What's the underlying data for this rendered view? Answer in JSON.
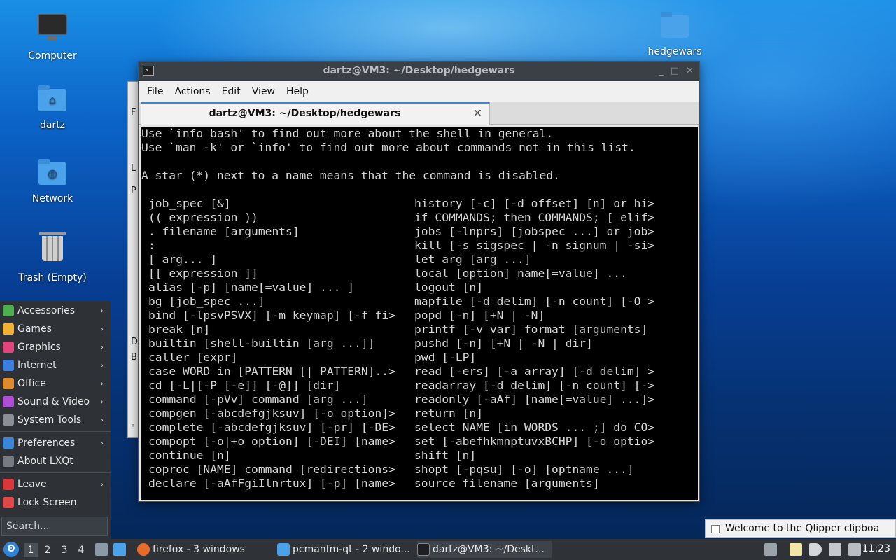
{
  "desktop": {
    "icons": [
      {
        "label": "Computer"
      },
      {
        "label": "dartz"
      },
      {
        "label": "Network"
      },
      {
        "label": "Trash (Empty)"
      },
      {
        "label": "hedgewars"
      }
    ]
  },
  "terminal": {
    "title": "dartz@VM3: ~/Desktop/hedgewars",
    "menu": [
      "File",
      "Actions",
      "Edit",
      "View",
      "Help"
    ],
    "tab_label": "dartz@VM3: ~/Desktop/hedgewars",
    "header_lines": [
      "Use `info bash' to find out more about the shell in general.",
      "Use `man -k' or `info' to find out more about commands not in this list.",
      "",
      "A star (*) next to a name means that the command is disabled."
    ],
    "left_column": [
      "job_spec [&]",
      "(( expression ))",
      ". filename [arguments]",
      ":",
      "[ arg... ]",
      "[[ expression ]]",
      "alias [-p] [name[=value] ... ]",
      "bg [job_spec ...]",
      "bind [-lpsvPSVX] [-m keymap] [-f fi>",
      "break [n]",
      "builtin [shell-builtin [arg ...]]",
      "caller [expr]",
      "case WORD in [PATTERN [| PATTERN]..>",
      "cd [-L|[-P [-e]] [-@]] [dir]",
      "command [-pVv] command [arg ...]",
      "compgen [-abcdefgjksuv] [-o option]>",
      "complete [-abcdefgjksuv] [-pr] [-DE>",
      "compopt [-o|+o option] [-DEI] [name>",
      "continue [n]",
      "coproc [NAME] command [redirections>",
      "declare [-aAfFgiIlnrtux] [-p] [name>"
    ],
    "right_column": [
      "history [-c] [-d offset] [n] or hi>",
      "if COMMANDS; then COMMANDS; [ elif>",
      "jobs [-lnprs] [jobspec ...] or job>",
      "kill [-s sigspec | -n signum | -si>",
      "let arg [arg ...]",
      "local [option] name[=value] ...",
      "logout [n]",
      "mapfile [-d delim] [-n count] [-O >",
      "popd [-n] [+N | -N]",
      "printf [-v var] format [arguments]",
      "pushd [-n] [+N | -N | dir]",
      "pwd [-LP]",
      "read [-ers] [-a array] [-d delim] >",
      "readarray [-d delim] [-n count] [->",
      "readonly [-aAf] [name[=value] ...]>",
      "return [n]",
      "select NAME [in WORDS ... ;] do CO>",
      "set [-abefhkmnptuvxBCHP] [-o optio>",
      "shift [n]",
      "shopt [-pqsu] [-o] [optname ...]",
      "source filename [arguments]"
    ]
  },
  "background_window": {
    "fragments": [
      "F",
      "L",
      "P",
      "D",
      "B",
      "\""
    ]
  },
  "start_menu": {
    "items": [
      {
        "label": "Accessories",
        "icon": "accessories-icon",
        "color": "#4caf50"
      },
      {
        "label": "Games",
        "icon": "games-icon",
        "color": "#f2b134"
      },
      {
        "label": "Graphics",
        "icon": "graphics-icon",
        "color": "#e0457b"
      },
      {
        "label": "Internet",
        "icon": "internet-icon",
        "color": "#3d7fe0"
      },
      {
        "label": "Office",
        "icon": "office-icon",
        "color": "#e08a2e"
      },
      {
        "label": "Sound & Video",
        "icon": "sound-video-icon",
        "color": "#b04fd6"
      },
      {
        "label": "System Tools",
        "icon": "system-tools-icon",
        "color": "#8a8f95"
      }
    ],
    "items2": [
      {
        "label": "Preferences",
        "icon": "preferences-icon",
        "color": "#3b86d9"
      },
      {
        "label": "About LXQt",
        "icon": "about-icon",
        "color": "#777c82"
      }
    ],
    "items3": [
      {
        "label": "Leave",
        "icon": "leave-icon",
        "color": "#d9383a"
      },
      {
        "label": "Lock Screen",
        "icon": "lock-icon",
        "color": "#e04848"
      }
    ],
    "search_placeholder": "Search..."
  },
  "notification": {
    "text": "Welcome to the Qlipper clipboa"
  },
  "taskbar": {
    "workspaces": [
      "1",
      "2",
      "3",
      "4"
    ],
    "tasks": [
      {
        "label": "firefox - 3 windows",
        "icon": "firefox-icon",
        "color": "#e66a2c"
      },
      {
        "label": "pcmanfm-qt - 2 windo...",
        "icon": "folder-icon",
        "color": "#4aa3ea"
      },
      {
        "label": "dartz@VM3: ~/Deskt...",
        "icon": "terminal-icon",
        "color": "#3b4047"
      }
    ],
    "clock": "11:23"
  }
}
